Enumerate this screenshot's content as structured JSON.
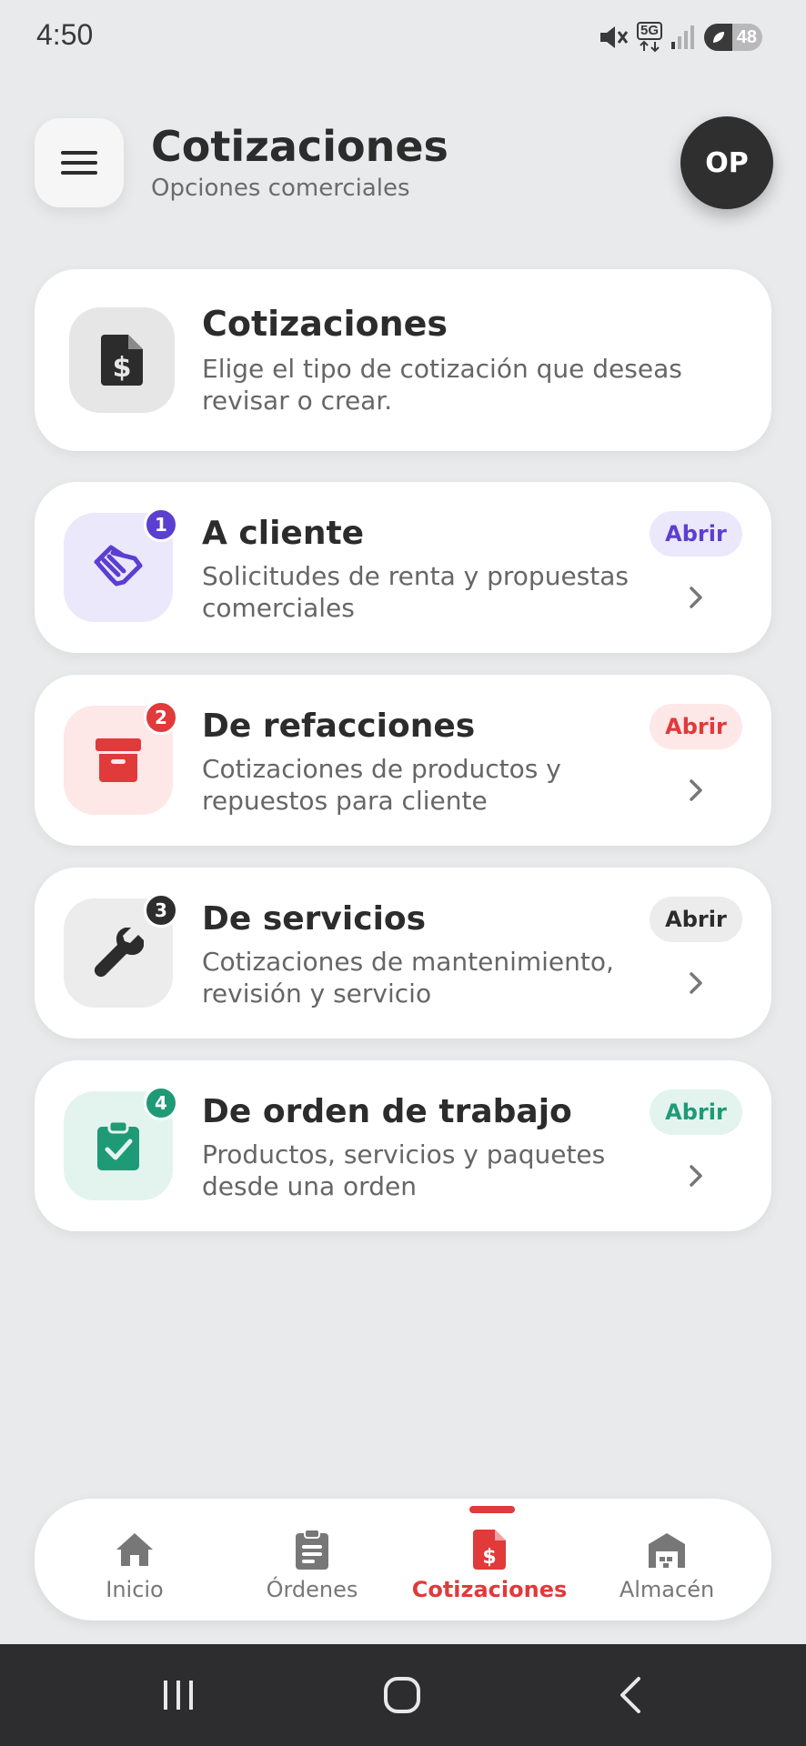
{
  "status_bar": {
    "time": "4:50",
    "battery_level": "48",
    "network": "5G"
  },
  "header": {
    "title": "Cotizaciones",
    "subtitle": "Opciones comerciales",
    "avatar_initials": "OP",
    "menu_icon": "hamburger-menu-icon"
  },
  "intro": {
    "title": "Cotizaciones",
    "description": "Elige el tipo de cotización que deseas revisar o crear.",
    "icon": "quote-document-icon"
  },
  "options": [
    {
      "number": "1",
      "title": "A cliente",
      "description": "Solicitudes de renta y propuestas comerciales",
      "action": "Abrir",
      "icon": "handshake-icon",
      "accent": "#5b3fd1",
      "tint": "#ece8fb"
    },
    {
      "number": "2",
      "title": "De refacciones",
      "description": "Cotizaciones de productos y repuestos para cliente",
      "action": "Abrir",
      "icon": "archive-box-icon",
      "accent": "#e03a3a",
      "tint": "#fde7e7"
    },
    {
      "number": "3",
      "title": "De servicios",
      "description": "Cotizaciones de mantenimiento, revisión y servicio",
      "action": "Abrir",
      "icon": "wrench-icon",
      "accent": "#2e2e2e",
      "tint": "#ececec"
    },
    {
      "number": "4",
      "title": "De orden de trabajo",
      "description": "Productos, servicios y paquetes desde una orden",
      "action": "Abrir",
      "icon": "clipboard-check-icon",
      "accent": "#1f9a77",
      "tint": "#e3f4ee"
    }
  ],
  "bottom_nav": [
    {
      "label": "Inicio",
      "icon": "home-icon",
      "active": false
    },
    {
      "label": "Órdenes",
      "icon": "clipboard-list-icon",
      "active": false
    },
    {
      "label": "Cotizaciones",
      "icon": "quote-document-icon",
      "active": true
    },
    {
      "label": "Almacén",
      "icon": "warehouse-icon",
      "active": false
    }
  ],
  "colors": {
    "background": "#e9eaec",
    "active_nav": "#e03a3a"
  }
}
